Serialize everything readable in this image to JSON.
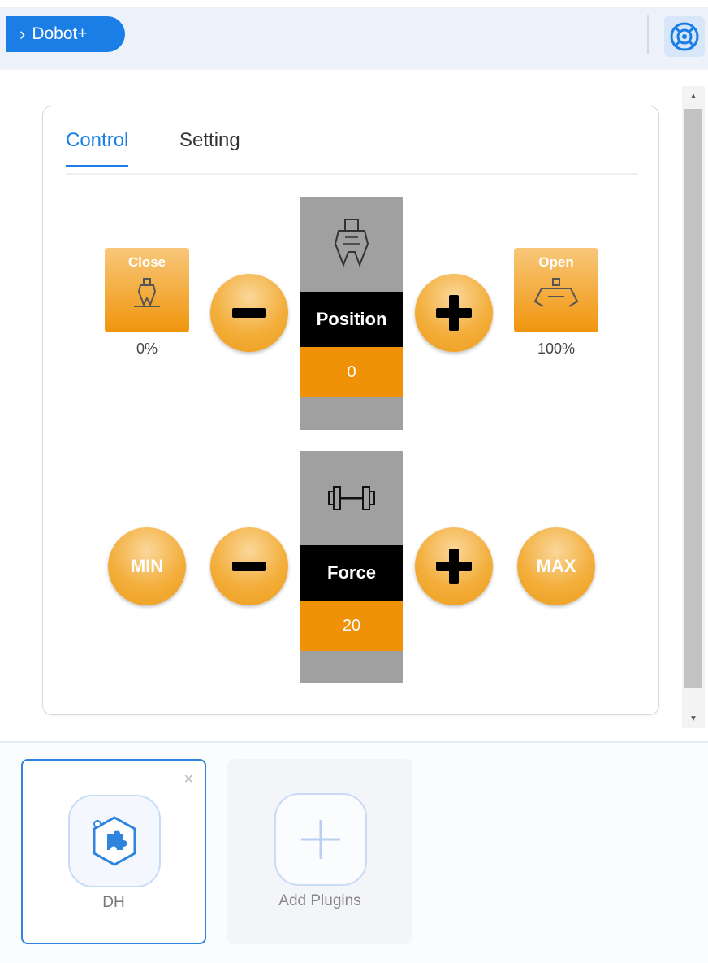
{
  "header": {
    "plugin_button_label": "Dobot+",
    "plugin_button_chevron": "chevron-right-icon",
    "support_icon": "lifebuoy-icon",
    "accent_color": "#1a7ee6"
  },
  "tabs": [
    {
      "label": "Control",
      "active": true
    },
    {
      "label": "Setting",
      "active": false
    }
  ],
  "control": {
    "close": {
      "label": "Close",
      "percent": "0%",
      "icon": "gripper-closed-icon"
    },
    "open": {
      "label": "Open",
      "percent": "100%",
      "icon": "gripper-open-icon"
    },
    "position": {
      "label": "Position",
      "value": "0",
      "icon": "gripper-icon"
    },
    "force": {
      "label": "Force",
      "value": "20",
      "icon": "dumbbell-icon"
    },
    "min_label": "MIN",
    "max_label": "MAX",
    "minus_icon": "minus-icon",
    "plus_icon": "plus-icon",
    "button_color": "#f0950c",
    "value_color": "#ef9207"
  },
  "plugins": {
    "items": [
      {
        "label": "DH",
        "icon": "puzzle-piece-icon",
        "selected": true
      }
    ],
    "add_label": "Add Plugins",
    "close_glyph": "×"
  }
}
